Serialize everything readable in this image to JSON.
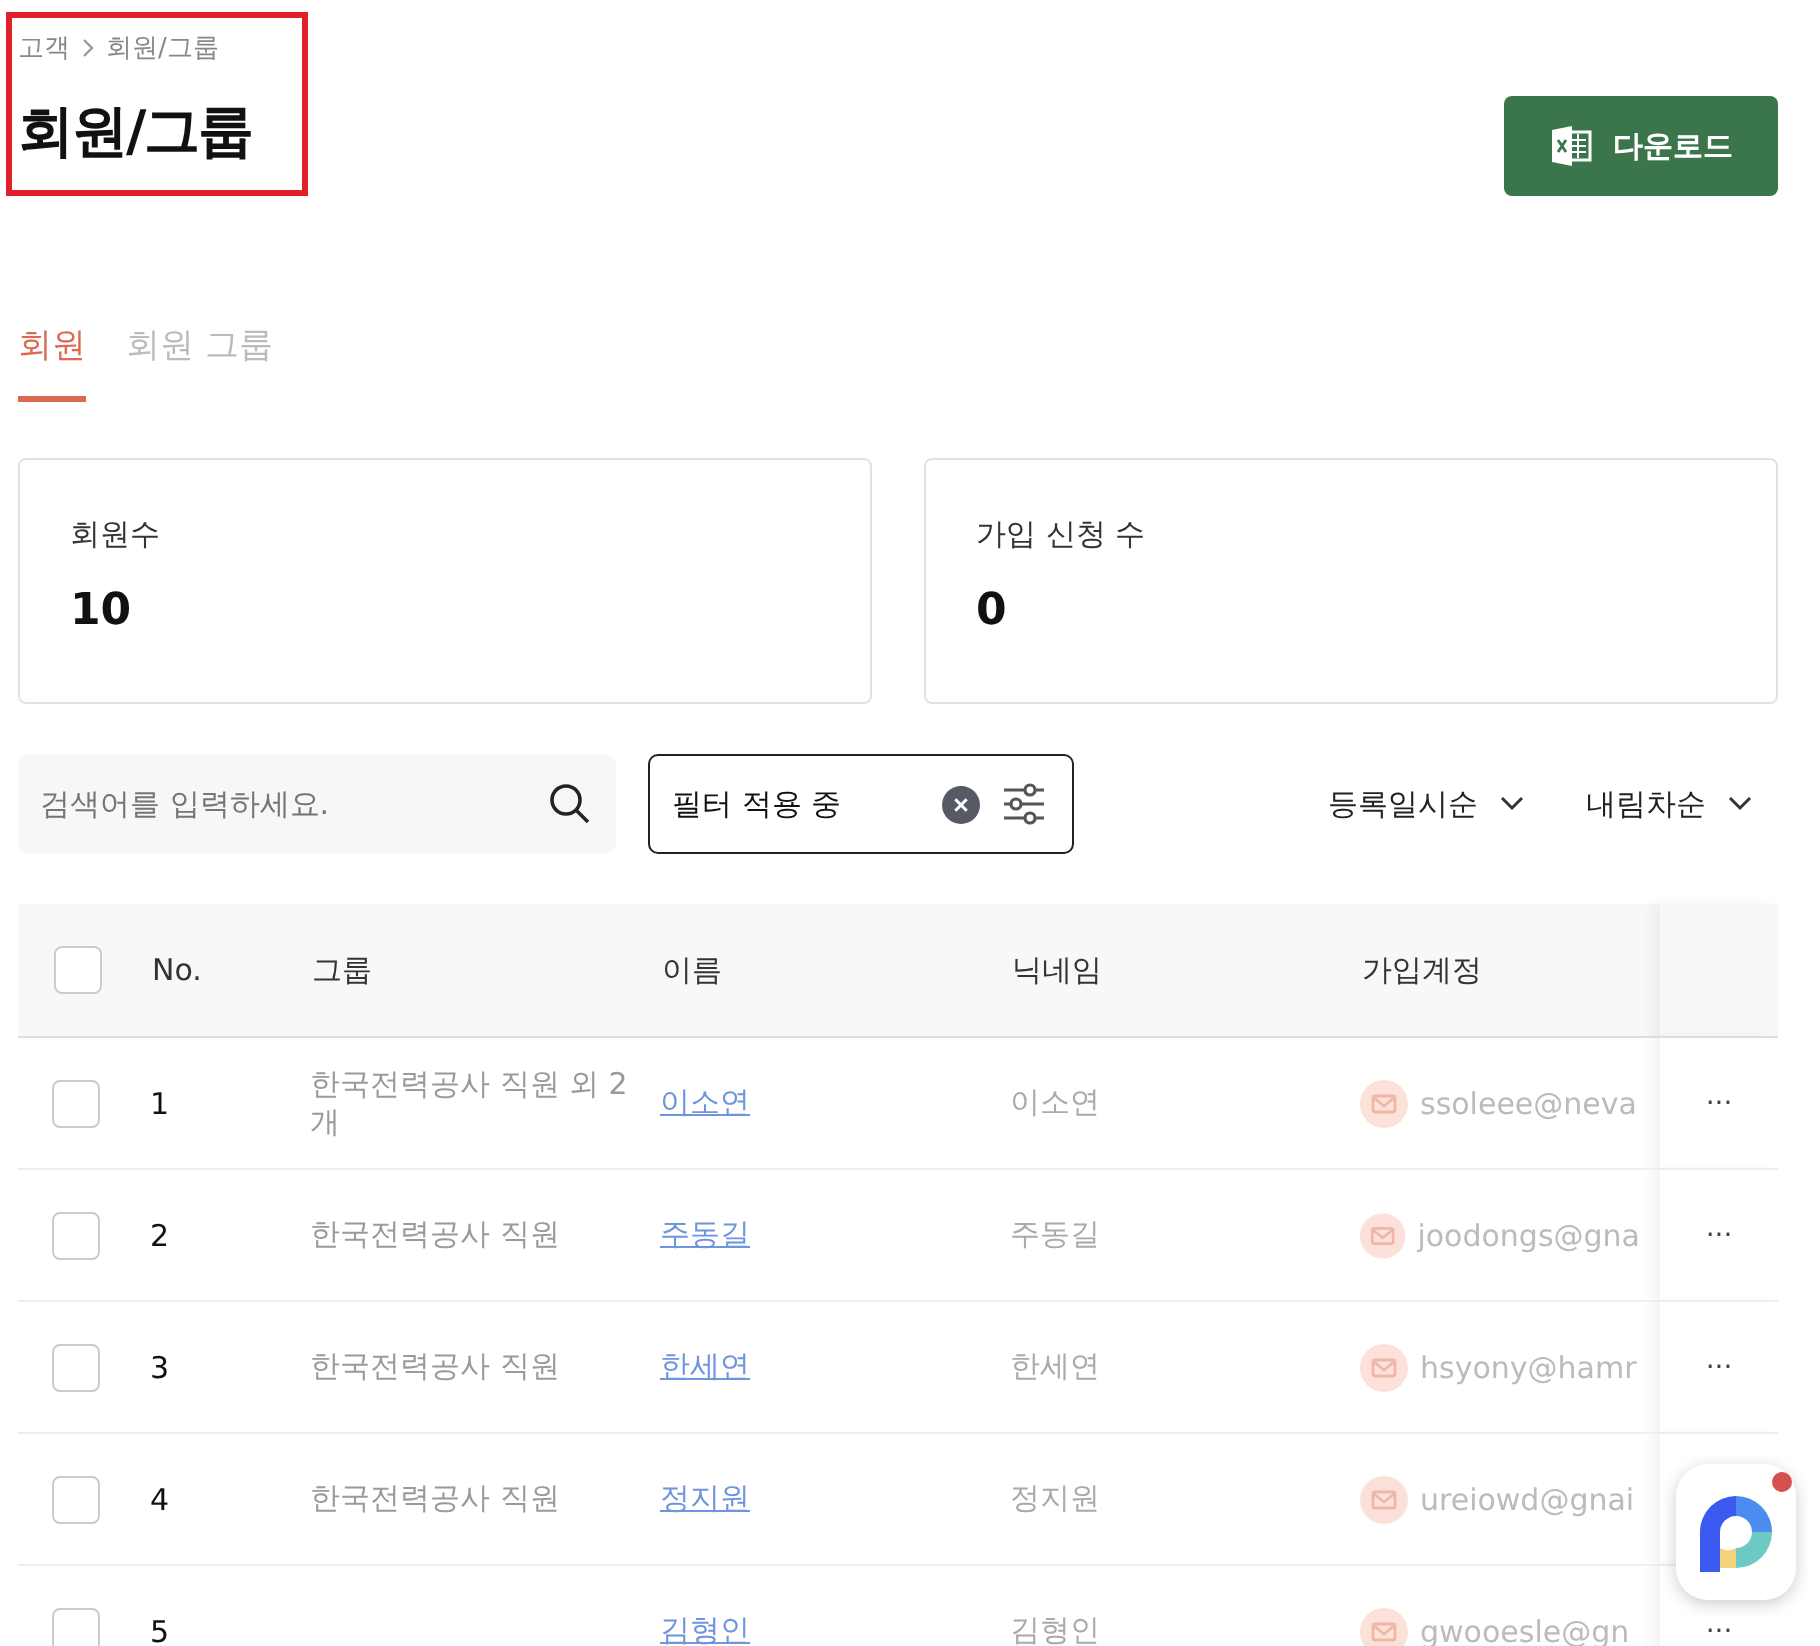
{
  "breadcrumb": [
    "고객",
    "회원/그룹"
  ],
  "title": "회원/그룹",
  "download_button": "다운로드",
  "tabs": [
    {
      "label": "회원",
      "selected": true
    },
    {
      "label": "회원 그룹",
      "selected": false
    }
  ],
  "stats": [
    {
      "label": "회원수",
      "value": "10"
    },
    {
      "label": "가입 신청 수",
      "value": "0"
    }
  ],
  "search": {
    "placeholder": "검색어를 입력하세요."
  },
  "filter": {
    "label": "필터 적용 중"
  },
  "sorts": [
    "등록일시순",
    "내림차순"
  ],
  "table": {
    "all_checked": false,
    "columns": [
      "No.",
      "그룹",
      "이름",
      "닉네임",
      "가입계정"
    ],
    "rows": [
      {
        "checked": false,
        "no": "1",
        "group": "한국전력공사 직원 외 2개",
        "name": "이소연",
        "nickname": "이소연",
        "account": "ssoleee@neva",
        "more": "···"
      },
      {
        "checked": false,
        "no": "2",
        "group": "한국전력공사 직원",
        "name": "주동길",
        "nickname": "주동길",
        "account": "joodongs@gna",
        "more": "···"
      },
      {
        "checked": false,
        "no": "3",
        "group": "한국전력공사 직원",
        "name": "한세연",
        "nickname": "한세연",
        "account": "hsyony@hamr",
        "more": "···"
      },
      {
        "checked": false,
        "no": "4",
        "group": "한국전력공사 직원",
        "name": "정지원",
        "nickname": "정지원",
        "account": "ureiowd@gnai"
      },
      {
        "checked": false,
        "no": "5",
        "name": "김형인",
        "nickname": "김형인",
        "account": "gwooesle@gn",
        "more": "···"
      }
    ]
  }
}
